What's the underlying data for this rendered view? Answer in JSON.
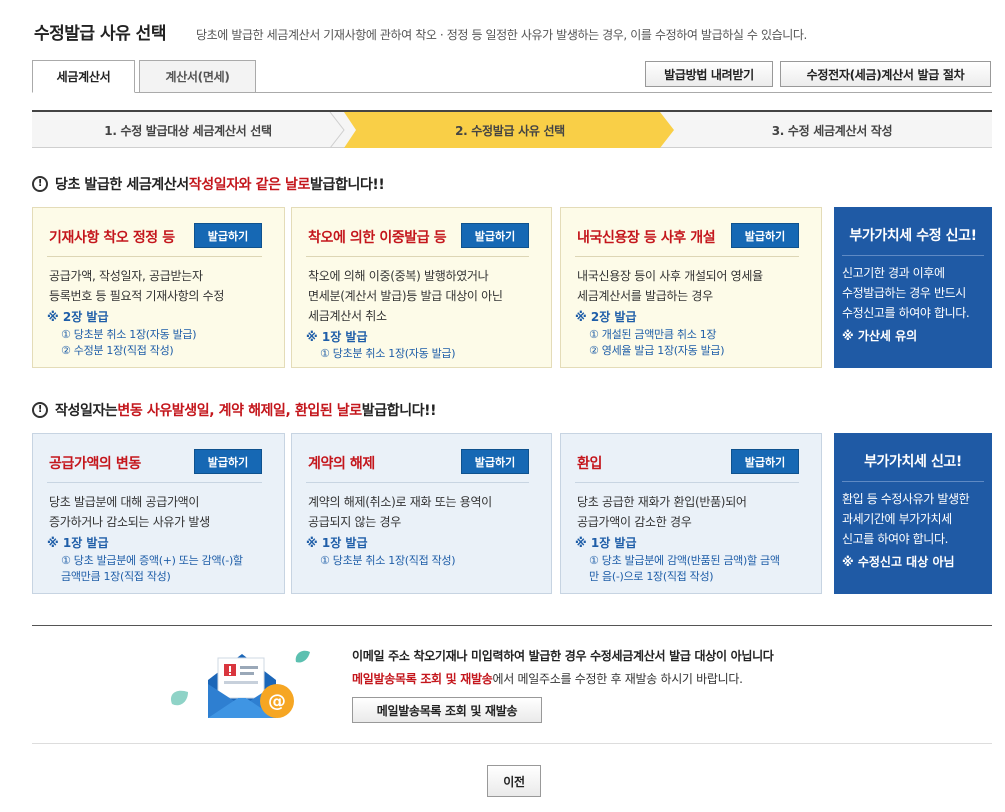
{
  "header": {
    "title": "수정발급 사유 선택",
    "description": "당초에 발급한 세금계산서 기재사항에 관하여 착오 · 정정 등 일정한 사유가 발생하는 경우, 이를 수정하여 발급하실 수 있습니다."
  },
  "tabs": [
    {
      "label": "세금계산서",
      "active": true
    },
    {
      "label": "계산서(면세)",
      "active": false
    }
  ],
  "top_buttons": {
    "download": "발급방법 내려받기",
    "procedure": "수정전자(세금)계산서 발급 절차"
  },
  "steps": [
    {
      "label": "1. 수정 발급대상 세금계산서 선택",
      "active": false
    },
    {
      "label": "2. 수정발급 사유 선택",
      "active": true
    },
    {
      "label": "3. 수정 세금계산서 작성",
      "active": false
    }
  ],
  "section1": {
    "head_a": "당초 발급한 세금계산서 ",
    "head_b": "작성일자와 같은 날로",
    "head_c": " 발급합니다!!",
    "cards": [
      {
        "title": "기재사항 착오 정정 등",
        "button": "발급하기",
        "body": [
          "공급가액, 작성일자, 공급받는자",
          "등록번호 등 필요적 기재사항의 수정"
        ],
        "note": "※ 2장 발급",
        "subs": [
          "① 당초분 취소 1장(자동 발급)",
          "② 수정분 1장(직접 작성)"
        ]
      },
      {
        "title": "착오에 의한 이중발급 등",
        "button": "발급하기",
        "body": [
          "착오에 의해 이중(중복) 발행하였거나",
          "면세분(계산서 발급)등 발급 대상이 아닌",
          "세금계산서 취소"
        ],
        "note": "※ 1장 발급",
        "subs": [
          "① 당초분 취소 1장(자동 발급)"
        ]
      },
      {
        "title": "내국신용장 등 사후 개설",
        "button": "발급하기",
        "body": [
          "내국신용장 등이 사후 개설되어 영세율",
          "세금계산서를 발급하는 경우"
        ],
        "note": "※ 2장 발급",
        "subs": [
          "① 개설된 금액만큼 취소 1장",
          "② 영세율 발급 1장(자동 발급)"
        ]
      }
    ],
    "side": {
      "title": "부가가치세 수정 신고!",
      "body": [
        "신고기한 경과 이후에",
        "수정발급하는 경우 반드시",
        "수정신고를 하여야 합니다."
      ],
      "note": "※ 가산세 유의"
    }
  },
  "section2": {
    "head_a": "작성일자는 ",
    "head_b": "변동 사유발생일, 계약 해제일, 환입된 날로",
    "head_c": " 발급합니다!!",
    "cards": [
      {
        "title": "공급가액의 변동",
        "button": "발급하기",
        "body": [
          "당초 발급분에 대해 공급가액이",
          "증가하거나 감소되는 사유가 발생"
        ],
        "note": "※ 1장 발급",
        "subs": [
          "① 당초 발급분에 증액(+) 또는 감액(-)할",
          "금액만큼 1장(직접 작성)"
        ]
      },
      {
        "title": "계약의 해제",
        "button": "발급하기",
        "body": [
          "계약의 해제(취소)로 재화 또는 용역이",
          "공급되지 않는 경우"
        ],
        "note": "※ 1장 발급",
        "subs": [
          "① 당초분 취소 1장(직접 작성)"
        ]
      },
      {
        "title": "환입",
        "button": "발급하기",
        "body": [
          "당초 공급한 재화가 환입(반품)되어",
          "공급가액이 감소한 경우"
        ],
        "note": "※ 1장 발급",
        "subs": [
          "① 당초 발급분에 감액(반품된 금액)할 금액",
          "만 음(-)으로 1장(직접 작성)"
        ]
      }
    ],
    "side": {
      "title": "부가가치세 신고!",
      "body": [
        "환입 등 수정사유가 발생한",
        "과세기간에 부가가치세",
        "신고를 하여야 합니다."
      ],
      "note": "※ 수정신고 대상 아님"
    }
  },
  "notice": {
    "line1": "이메일 주소 착오기재나 미입력하여 발급한 경우 수정세금계산서 발급 대상이 아닙니다",
    "line2_red": "메일발송목록 조회 및 재발송",
    "line2_rest": "에서 메일주소를 수정한 후 재발송 하시기 바랍니다.",
    "resend_button": "메일발송목록 조회 및 재발송"
  },
  "footer": {
    "prev_button": "이전"
  },
  "colors": {
    "accent_red": "#c4161c",
    "button_blue": "#1668b4",
    "side_blue": "#1f5aa5",
    "step_active": "#f9cf47"
  }
}
